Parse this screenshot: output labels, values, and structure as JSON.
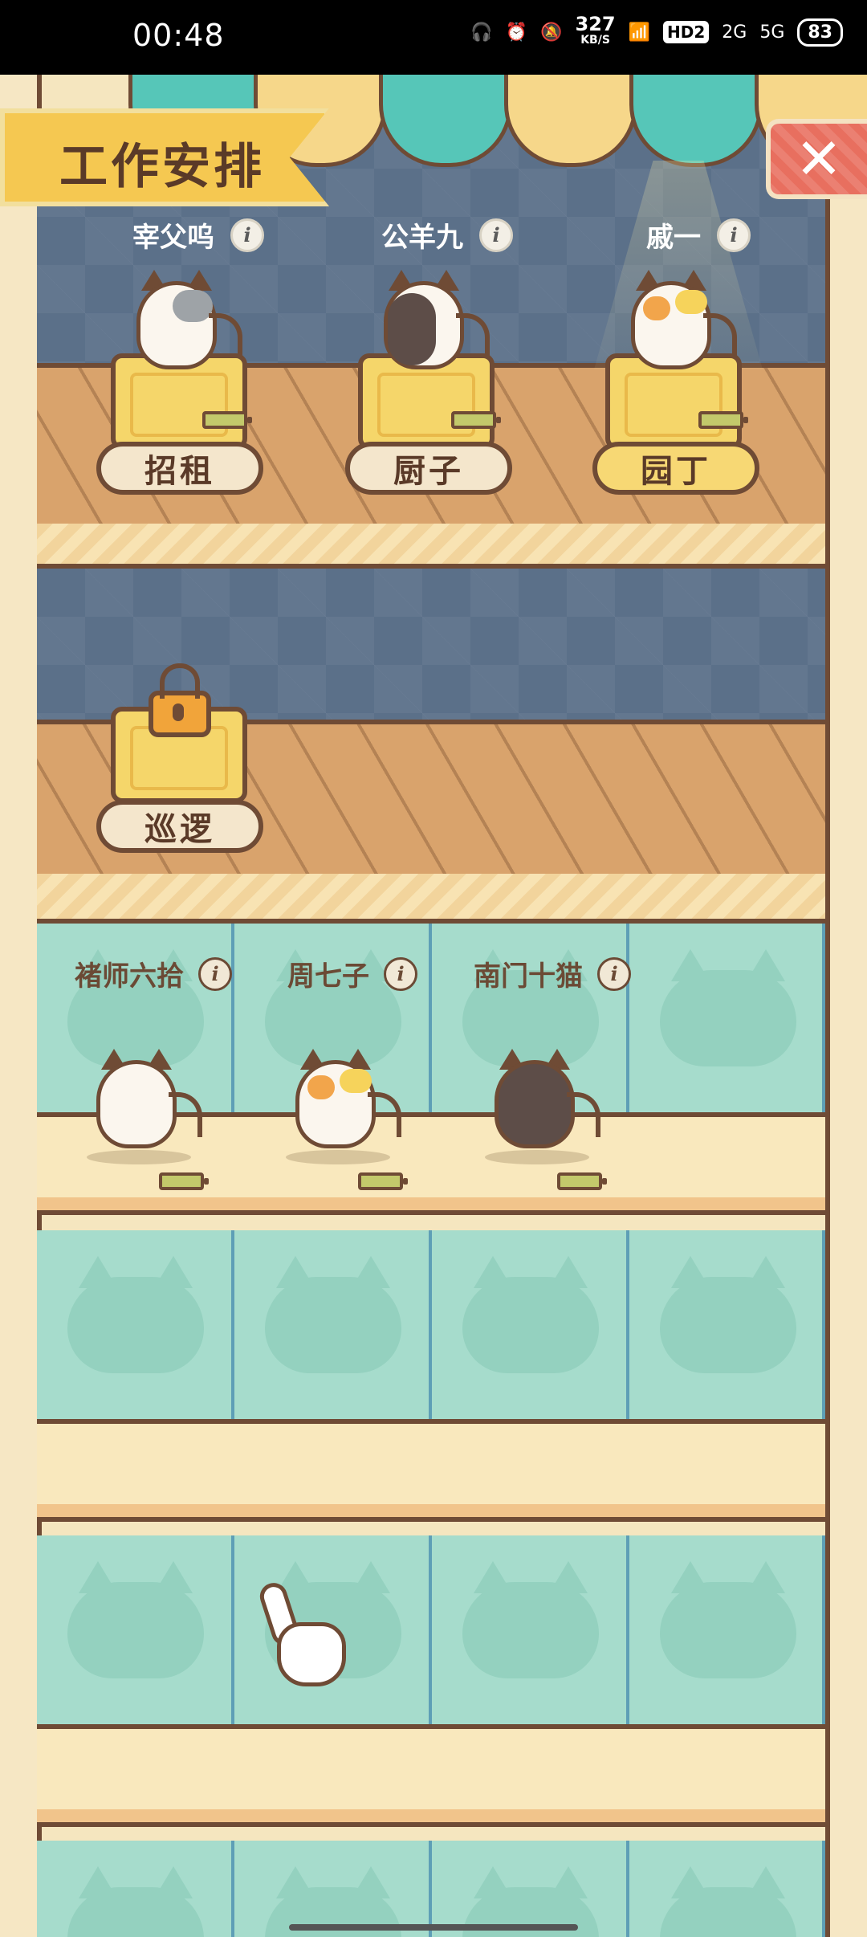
{
  "status_bar": {
    "time": "00:48",
    "net_speed": "327",
    "net_speed_unit": "KB/S",
    "hd_label": "HD2",
    "sig1": "2G",
    "sig2": "5G",
    "battery": "83"
  },
  "header": {
    "title": "工作安排"
  },
  "assigned_workers": [
    {
      "name": "宰父呜",
      "job": "招租",
      "job_active": false
    },
    {
      "name": "公羊九",
      "job": "厨子",
      "job_active": false
    },
    {
      "name": "戚一",
      "job": "园丁",
      "job_active": true
    }
  ],
  "locked_station": {
    "job": "巡逻"
  },
  "bench_workers": [
    {
      "name": "褚师六拾"
    },
    {
      "name": "周七子"
    },
    {
      "name": "南门十猫"
    }
  ],
  "colors": {
    "accent": "#f5c851",
    "wood_dark": "#6f4b35",
    "teal": "#a6dccc",
    "close": "#e86f5f"
  }
}
